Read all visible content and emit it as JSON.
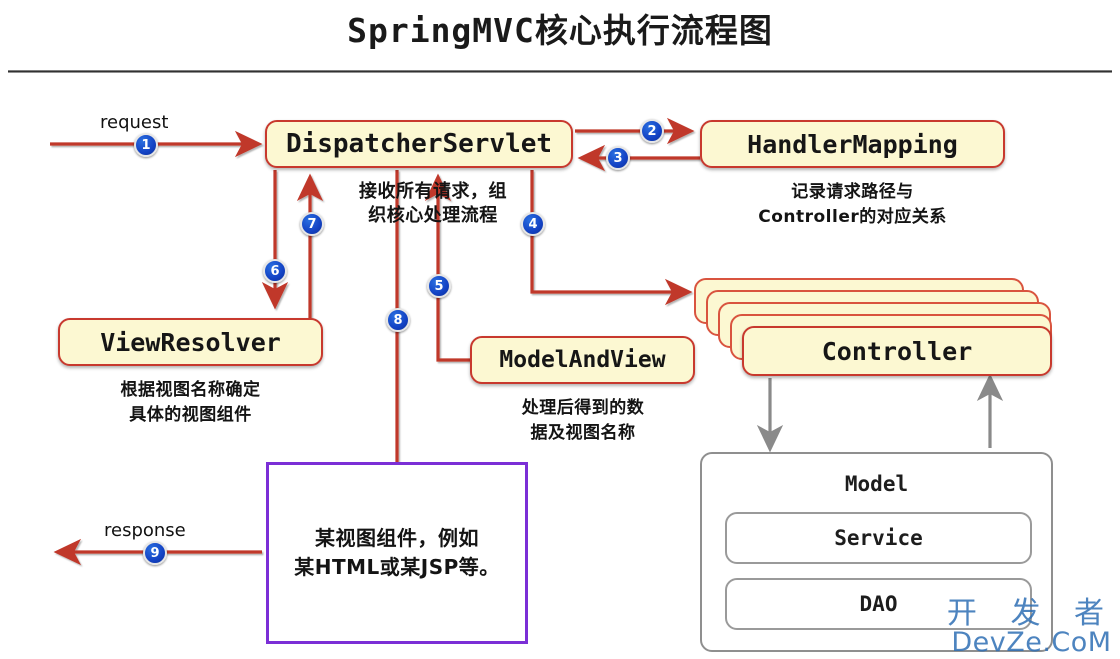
{
  "title": "SpringMVC核心执行流程图",
  "nodes": {
    "dispatcher": "DispatcherServlet",
    "handler_mapping": "HandlerMapping",
    "view_resolver": "ViewResolver",
    "model_and_view": "ModelAndView",
    "controller": "Controller",
    "model": "Model",
    "service": "Service",
    "dao": "DAO"
  },
  "captions": {
    "handler_mapping_line1": "记录请求路径与",
    "handler_mapping_line2": "Controller的对应关系",
    "view_resolver_line1": "根据视图名称确定",
    "view_resolver_line2": "具体的视图组件",
    "model_and_view_line1": "处理后得到的数",
    "model_and_view_line2": "据及视图名称",
    "dispatcher_note_line1": "接收所有请求，组",
    "dispatcher_note_line2": "织核心处理流程",
    "view_component_line1": "某视图组件，例如",
    "view_component_line2": "某HTML或某JSP等。"
  },
  "edge_labels": {
    "request": "request",
    "response": "response"
  },
  "steps": {
    "s1": "1",
    "s2": "2",
    "s3": "3",
    "s4": "4",
    "s5": "5",
    "s6": "6",
    "s7": "7",
    "s8": "8",
    "s9": "9"
  },
  "watermark": {
    "cn": "开 发 者",
    "en": "DevZe.CoM"
  },
  "colors": {
    "box_fill": "#fcf8d2",
    "box_border": "#c8392e",
    "arrow_red": "#c0392b",
    "arrow_gray": "#8a8a8a",
    "view_box_border": "#7b2fd6",
    "badge_blue": "#1342c4",
    "watermark_blue": "#2f6fb5"
  }
}
